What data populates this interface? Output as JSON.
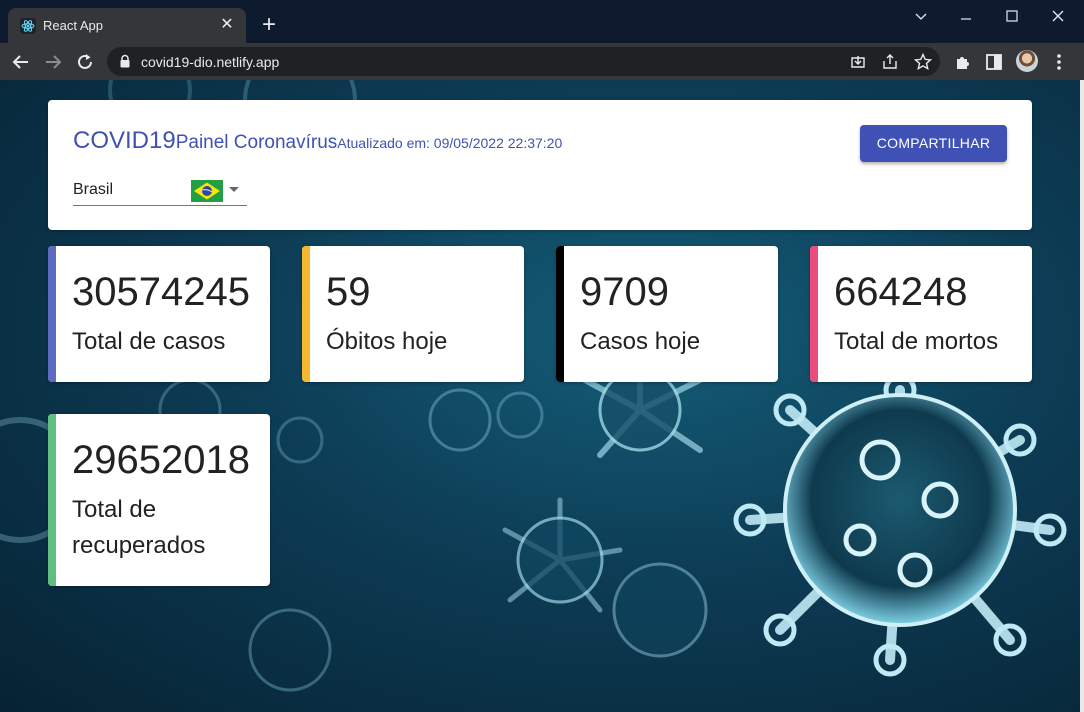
{
  "browser": {
    "tab_title": "React App",
    "url": "covid19-dio.netlify.app"
  },
  "header": {
    "title": "COVID19",
    "subtitle": "Painel Coronavírus",
    "updated": "Atualizado em: 09/05/2022 22:37:20",
    "share_label": "COMPARTILHAR"
  },
  "country_select": {
    "value": "Brasil",
    "flag_icon": "brazil-flag-icon"
  },
  "stats": [
    {
      "value": "30574245",
      "label": "Total de casos",
      "color": "#5c6bc0"
    },
    {
      "value": "59",
      "label": "Óbitos hoje",
      "color": "#f5b82e"
    },
    {
      "value": "9709",
      "label": "Casos hoje",
      "color": "#000000"
    },
    {
      "value": "664248",
      "label": "Total de mortos",
      "color": "#e84d7b"
    },
    {
      "value": "29652018",
      "label": "Total de recuperados",
      "color": "#5fbf7f"
    }
  ],
  "colors": {
    "primary": "#3f51b5",
    "background": "#0d3c55"
  }
}
